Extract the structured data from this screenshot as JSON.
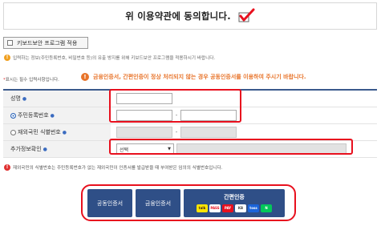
{
  "header": {
    "title": "위 이용약관에 동의합니다.",
    "check_icon": "check-mark-icon",
    "check_color": "#e8101e"
  },
  "keyboard_security": {
    "label": "키보드보안 프로그램 적용",
    "checked": false
  },
  "info": {
    "text": "입력하는 정보(주민등록번호, 비밀번호 등)의 유출 방지를 위해 키보드보안 프로그램을 적용하시기 바랍니다."
  },
  "required_notice": {
    "star": "*",
    "text": "표시는 필수 입력사항입니다."
  },
  "alert": {
    "text": "금융인증서, 간편인증이 정상 처리되지 않는 경우 공동인증서를 이용하여 주시기 바랍니다."
  },
  "form": {
    "name": {
      "label": "성명",
      "value": ""
    },
    "resident_number": {
      "label": "주민등록번호",
      "selected": true,
      "first": "",
      "second": ""
    },
    "foreigner_number": {
      "label": "재외국민 식별번호",
      "selected": false
    },
    "additional_auth": {
      "label": "추가정보확인",
      "select_value": "선택",
      "input_value": ""
    }
  },
  "note": {
    "text": "재외국민의 식별번호는 주민등록번호가 없는 재외국민이 인증서를 발급받을 때 부여받은 임의의 식별번호입니다."
  },
  "buttons": {
    "joint_cert": "공동인증서",
    "financial_cert": "금융인증서",
    "simple_auth": "간편인증",
    "providers": [
      {
        "name": "kakao-icon",
        "label": "talk",
        "bg": "#fee500",
        "fg": "#3a1d1d"
      },
      {
        "name": "pass-icon",
        "label": "PASS",
        "bg": "#ffffff",
        "fg": "#e8101e"
      },
      {
        "name": "payco-icon",
        "label": "PAY",
        "bg": "#e8101e",
        "fg": "#ffffff"
      },
      {
        "name": "samsung-pass-icon",
        "label": "KB",
        "bg": "#ffffff",
        "fg": "#444444"
      },
      {
        "name": "toss-icon",
        "label": "toss",
        "bg": "#1b64da",
        "fg": "#ffffff"
      },
      {
        "name": "naver-icon",
        "label": "N",
        "bg": "#03c75a",
        "fg": "#ffffff"
      }
    ]
  },
  "colors": {
    "accent": "#2f4f87",
    "highlight": "#e8101e",
    "alert": "#e8742a"
  }
}
